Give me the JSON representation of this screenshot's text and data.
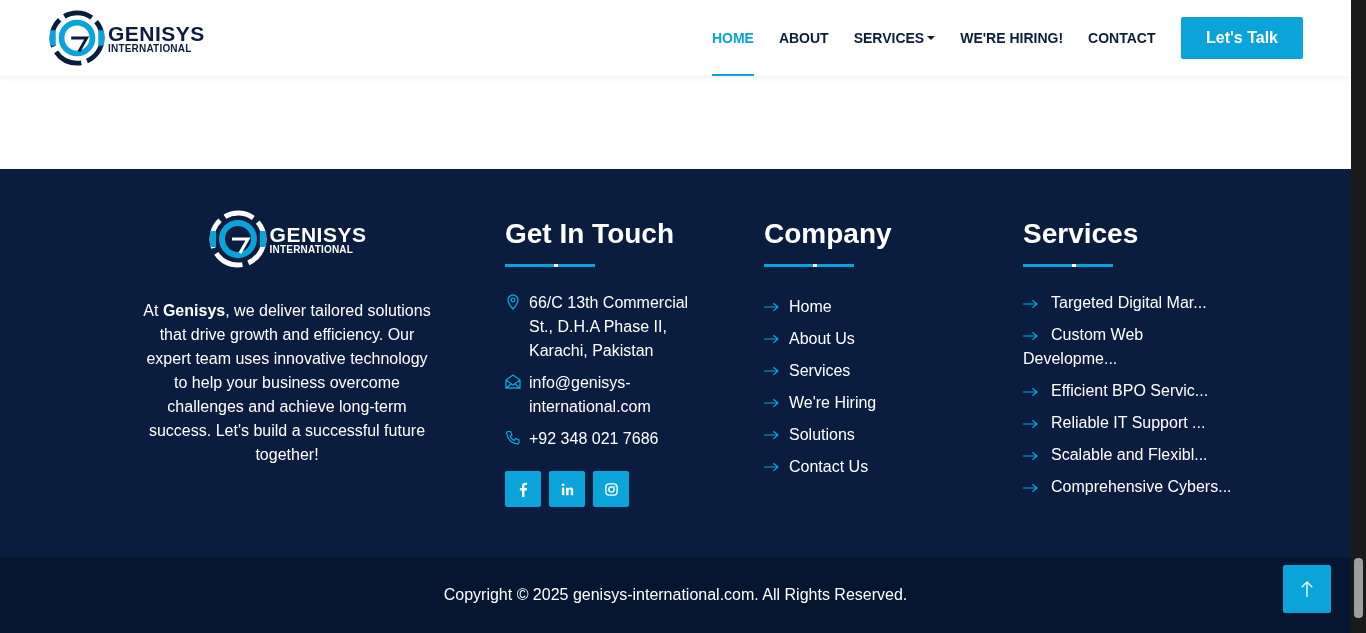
{
  "header": {
    "logo": {
      "name": "GENISYS",
      "sub": "INTERNATIONAL"
    },
    "nav": [
      {
        "label": "HOME",
        "selected": true,
        "dropdown": false
      },
      {
        "label": "ABOUT",
        "selected": false,
        "dropdown": false
      },
      {
        "label": "SERVICES",
        "selected": false,
        "dropdown": true
      },
      {
        "label": "WE'RE HIRING!",
        "selected": false,
        "dropdown": false
      },
      {
        "label": "CONTACT",
        "selected": false,
        "dropdown": false
      }
    ],
    "cta": "Let's Talk"
  },
  "footer": {
    "logo": {
      "name": "GENISYS",
      "sub": "INTERNATIONAL"
    },
    "about": "At **Genisys**, we deliver tailored solutions that drive growth and efficiency. Our expert team uses innovative technology to help your business overcome challenges and achieve long-term success. Let's build a successful future together!",
    "contact": {
      "title": "Get In Touch",
      "items": [
        {
          "kind": "location",
          "text": "66/C 13th Commercial St., D.H.A Phase II, Karachi, Pakistan"
        },
        {
          "kind": "email",
          "text": "info@genisys-international.com"
        },
        {
          "kind": "phone",
          "text": "+92 348 021 7686"
        }
      ],
      "social": [
        {
          "kind": "facebook"
        },
        {
          "kind": "linkedin"
        },
        {
          "kind": "instagram"
        }
      ]
    },
    "company": {
      "title": "Company",
      "links": [
        "Home",
        "About Us",
        "Services",
        "We're Hiring",
        "Solutions",
        "Contact Us"
      ]
    },
    "services": {
      "title": "Services",
      "links": [
        "Targeted Digital Mar...",
        "Custom Web Developme...",
        "Efficient BPO Servic...",
        "Reliable IT Support ...",
        "Scalable and Flexibl...",
        "Comprehensive Cybers..."
      ]
    },
    "copyright": "Copyright © 2025 genisys-international.com. All Rights Reserved."
  }
}
